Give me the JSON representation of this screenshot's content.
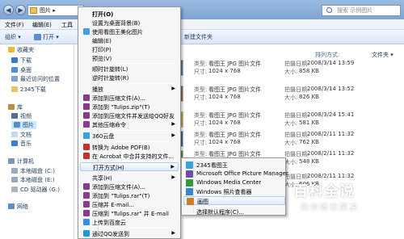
{
  "window": {
    "address": [
      "图片",
      "▸"
    ],
    "search_placeholder": "搜索 示例图片",
    "menubar": [
      "文件(F)",
      "编辑(E)",
      "工具"
    ],
    "toolbar": {
      "organize": "组织 ▾",
      "open": "打开 ▾",
      "new_folder": "新建文件夹"
    },
    "arrange_label": "排列方式:",
    "arrange_value": "文件夹 ▾"
  },
  "sidebar": [
    {
      "label": "收藏夹",
      "icon": "star-icon",
      "color": "#e8b93a"
    },
    {
      "label": "下载",
      "icon": "download-icon",
      "color": "#3d76c4"
    },
    {
      "label": "桌面",
      "icon": "desktop-icon",
      "color": "#4a90d9"
    },
    {
      "label": "最近访问的位置",
      "icon": "recent-icon",
      "color": "#7ea3cf"
    },
    {
      "label": "2345下载",
      "icon": "folder-icon",
      "color": "#e9c45c"
    },
    {
      "label": "库",
      "icon": "library-icon",
      "color": "#b88d3b"
    },
    {
      "label": "视频",
      "icon": "video-icon",
      "color": "#5b6b8c"
    },
    {
      "label": "图片",
      "icon": "picture-icon",
      "color": "#4f8ed1",
      "selected": true
    },
    {
      "label": "文档",
      "icon": "document-icon",
      "color": "#c9d7ea"
    },
    {
      "label": "音乐",
      "icon": "music-icon",
      "color": "#3b7dd8"
    },
    {
      "label": "计算机",
      "icon": "computer-icon",
      "color": "#7b97ba"
    },
    {
      "label": "本地磁盘 (C:)",
      "icon": "disk-icon",
      "color": "#9aa9bb"
    },
    {
      "label": "本地磁盘 (E:)",
      "icon": "disk-icon",
      "color": "#9aa9bb"
    },
    {
      "label": "CD 驱动器 (G:)",
      "icon": "cd-icon",
      "color": "#b3b3b3"
    },
    {
      "label": "网络",
      "icon": "network-icon",
      "color": "#5b8fc9"
    }
  ],
  "files": [
    {
      "type_label": "类型:",
      "type": "看图王 JPG 图片文件",
      "dim_label": "尺寸:",
      "dim": "1024 x 768",
      "date_label": "拍摄日期:",
      "date": "2008/3/14 13:59",
      "size_label": "大小:",
      "size": "858 KB",
      "color": "#5a7aa0"
    },
    {
      "type_label": "类型:",
      "type": "看图王 JPG 图片文件",
      "dim_label": "尺寸:",
      "dim": "1024 x 768",
      "date_label": "拍摄日期:",
      "date": "2008/3/14 13:52",
      "size_label": "大小:",
      "size": "826 KB",
      "color": "#8c6d4a"
    },
    {
      "type_label": "类型:",
      "type": "看图王 JPG 图片文件",
      "dim_label": "尺寸:",
      "dim": "1024 x 768",
      "date_label": "拍摄日期:",
      "date": "2008/3/24 15:41",
      "size_label": "大小:",
      "size": "581 KB",
      "color": "#c7a34a"
    },
    {
      "type_label": "类型:",
      "type": "看图王 JPG 图片文件",
      "dim_label": "尺寸:",
      "dim": "1024 x 768",
      "date_label": "拍摄日期:",
      "date": "2008/2/11 11:32",
      "size_label": "大小:",
      "size": "762 KB",
      "color": "#3d6e9e"
    },
    {
      "type_label": "类型:",
      "type": "看图王 JPG 图片文件",
      "dim_label": "尺寸:",
      "dim": "1024 x 768",
      "date_label": "拍摄日期:",
      "date": "2008/2/11 11:32",
      "size_label": "大小:",
      "size": "548 KB",
      "color": "#5e8a4a"
    },
    {
      "type_label": "类型:",
      "type": "看图王 JPG 图片文件",
      "dim_label": "尺寸:",
      "dim": "1024 x 768",
      "date_label": "拍摄日期:",
      "date": "2008/2/11 11:32",
      "size_label": "大小:",
      "size": "606 KB",
      "color": "#7e5a8e"
    }
  ],
  "context_menu": [
    {
      "label": "打开(O)",
      "bold": true
    },
    {
      "label": "设置为桌面背景(B)"
    },
    {
      "label": "使用看图王美化图片",
      "icon": "kantuwang-icon",
      "icon_color": "#3aa0e0"
    },
    {
      "label": "编辑(E)"
    },
    {
      "label": "打印(P)"
    },
    {
      "label": "预览(V)"
    },
    {
      "sep": true
    },
    {
      "label": "顺时针旋转(L)"
    },
    {
      "label": "逆时针旋转(R)"
    },
    {
      "sep": true
    },
    {
      "label": "播放",
      "arrow": true
    },
    {
      "label": "添加到压缩文件(A)...",
      "icon": "winrar-icon",
      "icon_color": "#8b3a8b"
    },
    {
      "label": "添加到 \"Tulips.zip\"(T)",
      "icon": "winrar-icon",
      "icon_color": "#8b3a8b"
    },
    {
      "label": "添加到压缩文件并发送给QQ好友",
      "icon": "winrar-icon",
      "icon_color": "#8b3a8b"
    },
    {
      "label": "其他压缩命令",
      "icon": "winrar-icon",
      "icon_color": "#8b3a8b",
      "arrow": true
    },
    {
      "sep": true
    },
    {
      "label": "360云盘",
      "icon": "cloud-icon",
      "icon_color": "#3aa0e0",
      "arrow": true
    },
    {
      "sep": true
    },
    {
      "label": "转换为 Adobe PDF(B)",
      "icon": "pdf-icon",
      "icon_color": "#c8302a"
    },
    {
      "label": "在 Acrobat 中合并支持的文件...",
      "icon": "acrobat-icon",
      "icon_color": "#c8302a"
    },
    {
      "sep": true
    },
    {
      "label": "打开方式(H)",
      "arrow": true,
      "highlight": true
    },
    {
      "sep": true
    },
    {
      "label": "共享(H)",
      "arrow": true
    },
    {
      "label": "添加到压缩文件(A)...",
      "icon": "winrar-icon",
      "icon_color": "#8b3a8b"
    },
    {
      "label": "添加到 \"Tulips.rar\"(T)",
      "icon": "winrar-icon",
      "icon_color": "#8b3a8b"
    },
    {
      "label": "压缩并 E-mail...",
      "icon": "winrar-icon",
      "icon_color": "#8b3a8b"
    },
    {
      "label": "压缩到 \"Tulips.rar\" 并 E-mail",
      "icon": "winrar-icon",
      "icon_color": "#8b3a8b"
    },
    {
      "label": "上传到百度云",
      "icon": "baidu-cloud-icon",
      "icon_color": "#2f8ee8"
    },
    {
      "sep": true
    },
    {
      "label": "通过QQ发送到",
      "icon": "qq-icon",
      "icon_color": "#1a9ad6",
      "arrow": true
    }
  ],
  "submenu": [
    {
      "label": "2345看图王",
      "icon": "kantuwang-icon",
      "icon_color": "#3aa0e0"
    },
    {
      "label": "Microsoft Office Picture Manager",
      "icon": "office-icon",
      "icon_color": "#6a4fa3"
    },
    {
      "label": "Windows Media Center",
      "icon": "media-center-icon",
      "icon_color": "#2e9b3c"
    },
    {
      "label": "Windows 照片查看器",
      "icon": "photo-viewer-icon",
      "icon_color": "#3a86c8"
    },
    {
      "label": "画图",
      "icon": "paint-icon",
      "icon_color": "#d07a2a",
      "highlight": true
    },
    {
      "sep": true
    },
    {
      "label": "选择默认程序(C)..."
    }
  ],
  "watermark": {
    "title": "百科全说",
    "subtitle": "助你轻松解决"
  }
}
